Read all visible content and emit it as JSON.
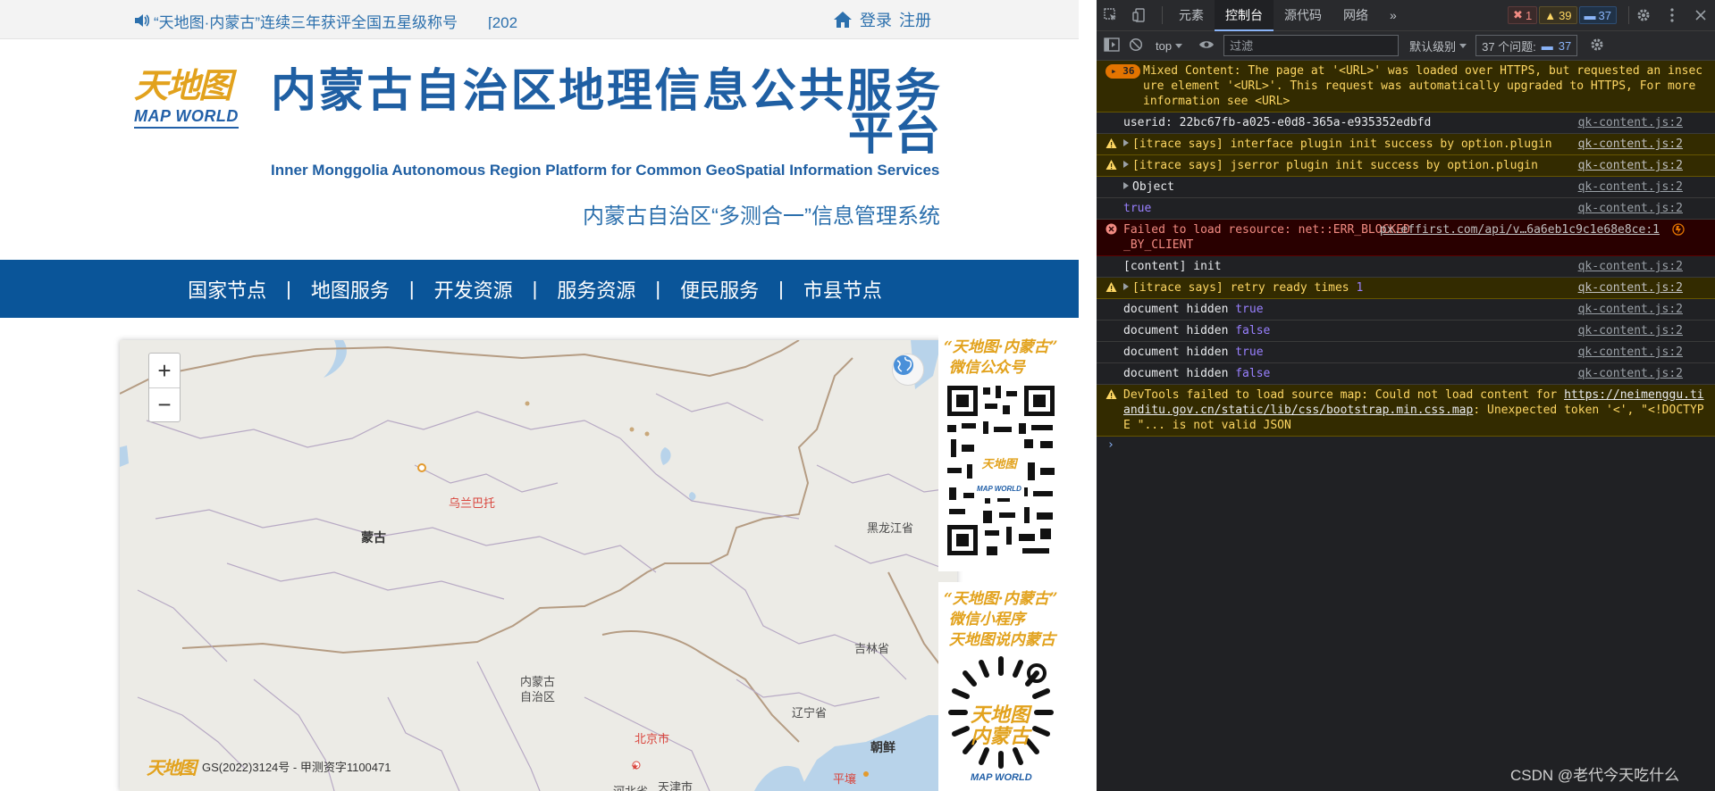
{
  "page": {
    "notice": "“天地图·内蒙古”连续三年获评全国五星级称号　　[202",
    "top_links": {
      "login": "登录",
      "register": "注册"
    },
    "logo": {
      "cn": "天地图",
      "en": "MAP WORLD"
    },
    "title": "内蒙古自治区地理信息公共服务平台",
    "subtitle_en": "Inner Monggolia Autonomous Region Platform for Common GeoSpatial Information Services",
    "system_name": "内蒙古自治区“多测合一”信息管理系统",
    "nav": [
      "国家节点",
      "地图服务",
      "开发资源",
      "服务资源",
      "便民服务",
      "市县节点"
    ],
    "nav_separator": "|",
    "map": {
      "zoom_in": "+",
      "zoom_out": "−",
      "labels": {
        "ulaanbaatar": "乌兰巴托",
        "mongolia": "蒙古",
        "heilongjiang": "黑龙江省",
        "jilin": "吉林省",
        "inner_mongolia": "内蒙古\n自治区",
        "liaoning": "辽宁省",
        "beijing": "北京市",
        "tianjin": "天津市",
        "hebei": "河北省",
        "korea": "朝鲜",
        "pyongyang": "平壤"
      },
      "copyright_logo": "天地图",
      "copyright": "GS(2022)3124号 - 甲测资字1100471"
    },
    "side_panels": [
      {
        "text": "“天地图·内蒙古”\n 微信公众号"
      },
      {
        "text": "“天地图·内蒙古”\n 微信小程序\n 天地图说内蒙古"
      }
    ],
    "side_panel_logo": "天地图\n内蒙古",
    "side_panel_logo_en": "MAP WORLD"
  },
  "devtools": {
    "tabs": [
      "元素",
      "控制台",
      "源代码",
      "网络"
    ],
    "active_tab": "控制台",
    "more": "»",
    "badges": {
      "errors": "1",
      "warnings": "39",
      "messages": "37"
    },
    "toolbar": {
      "context": "top",
      "filter_placeholder": "过滤",
      "level": "默认级别",
      "issues_label": "37 个问题:",
      "issues_count": "37"
    },
    "console": [
      {
        "type": "warn-group",
        "count": "36",
        "text": "Mixed Content: The page at '<URL>' was loaded over HTTPS, but requested an insecure element '<URL>'. This request was automatically upgraded to HTTPS, For more information see <URL>",
        "source": ""
      },
      {
        "type": "log",
        "text": "userid: 22bc67fb-a025-e0d8-365a-e935352edbfd",
        "source": "qk-content.js:2"
      },
      {
        "type": "warn",
        "expand": true,
        "text": "[itrace says] interface plugin init success by option.plugin",
        "source": "qk-content.js:2"
      },
      {
        "type": "warn",
        "expand": true,
        "text": "[itrace says] jserror plugin init success by option.plugin",
        "source": "qk-content.js:2"
      },
      {
        "type": "log",
        "expand": true,
        "text": "Object",
        "source": "qk-content.js:2"
      },
      {
        "type": "log",
        "keyword": "true",
        "text": "",
        "source": "qk-content.js:2"
      },
      {
        "type": "error",
        "text": "Failed to load resource: net::ERR_BLOCKED_BY_CLIENT",
        "source": "px.effirst.com/api/v…6a6eb1c9c1e68e8ce:1"
      },
      {
        "type": "log",
        "text": "[content] init",
        "source": "qk-content.js:2"
      },
      {
        "type": "warn",
        "expand": true,
        "text": "[itrace says] retry ready times ",
        "num": "1",
        "source": "qk-content.js:2"
      },
      {
        "type": "log",
        "text": "document hidden ",
        "keyword": "true",
        "source": "qk-content.js:2"
      },
      {
        "type": "log",
        "text": "document hidden ",
        "keyword": "false",
        "source": "qk-content.js:2"
      },
      {
        "type": "log",
        "text": "document hidden ",
        "keyword": "true",
        "source": "qk-content.js:2"
      },
      {
        "type": "log",
        "text": "document hidden ",
        "keyword": "false",
        "source": "qk-content.js:2"
      },
      {
        "type": "warn",
        "text": "DevTools failed to load source map: Could not load content for ",
        "link": "https://neimenggu.tianditu.gov.cn/static/lib/css/bootstrap.min.css.map",
        "text2": ": Unexpected token '<', \"<!DOCTYPE \"... is not valid JSON",
        "source": ""
      }
    ],
    "prompt": "›"
  },
  "watermark": "CSDN @老代今天吃什么",
  "colors": {
    "nav": "#0a5599",
    "title": "#1f5fa3",
    "gold": "#e2a21d",
    "devtools_bg": "#202124"
  }
}
